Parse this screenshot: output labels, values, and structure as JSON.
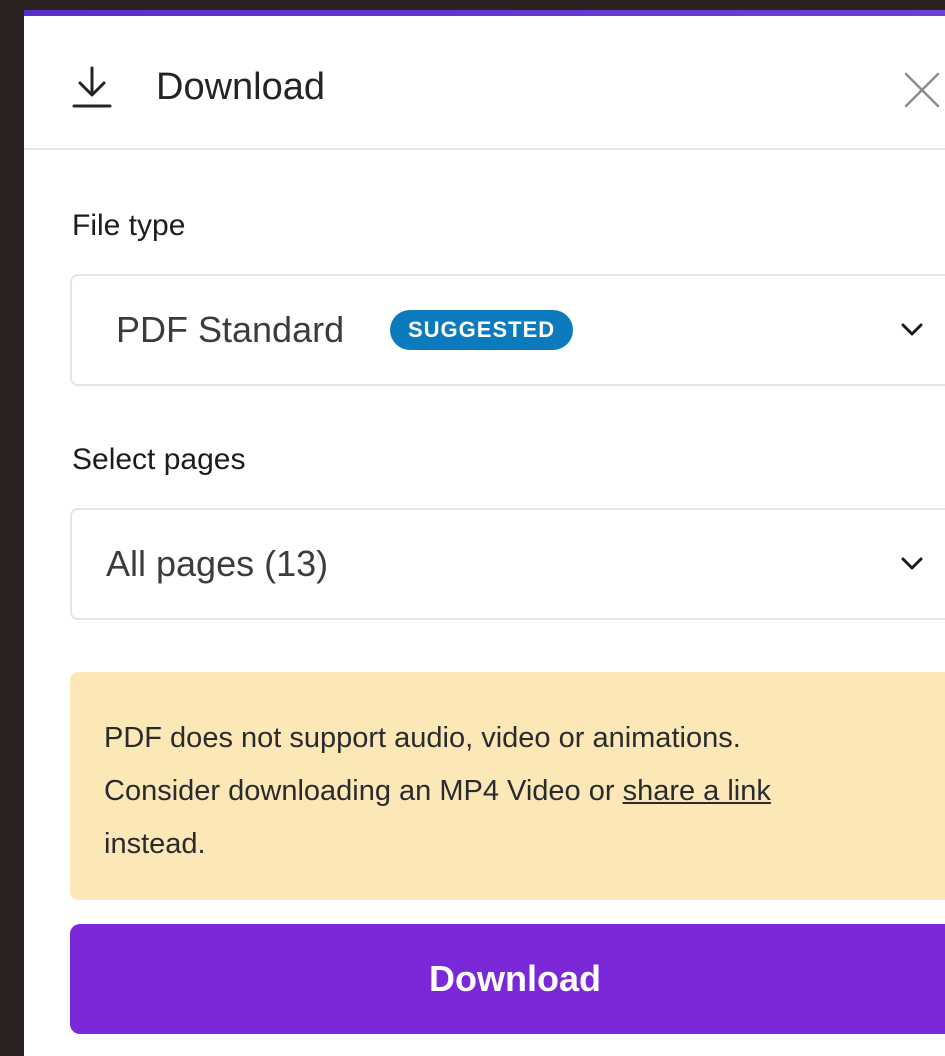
{
  "header": {
    "title": "Download",
    "download_icon": "download-arrow-icon",
    "close_icon": "close-x-icon"
  },
  "file_type": {
    "label": "File type",
    "selected": "PDF Standard",
    "badge": "SUGGESTED",
    "chevron_icon": "chevron-down-icon"
  },
  "pages": {
    "label": "Select pages",
    "selected": "All pages (13)",
    "chevron_icon": "chevron-down-icon"
  },
  "notice": {
    "line1": "PDF does not support audio, video or animations.",
    "line2_prefix": "Consider downloading an MP4 Video or ",
    "link_text": "share a link",
    "line3": "instead."
  },
  "download_button": {
    "label": "Download"
  },
  "colors": {
    "accent": "#7a28d8",
    "badge": "#0b7bbd",
    "notice_bg": "#fce8b6",
    "background": "#2a2322"
  }
}
